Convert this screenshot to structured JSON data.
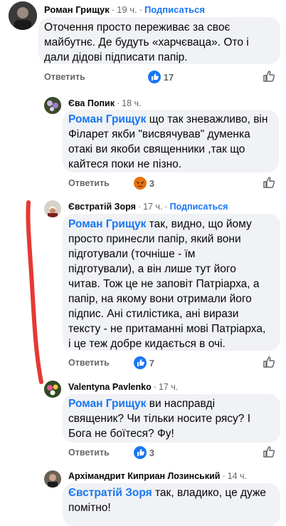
{
  "comments": [
    {
      "author": "Роман Грищук",
      "time": "19 ч.",
      "follow": "Подписаться",
      "mention": "",
      "lines": [
        "Оточення просто переживає за своє",
        "майбутнє. Де будуть «харчєваца». Ото і",
        "дали дідові підписати папір."
      ],
      "reply": "Ответить",
      "reaction_count": "17"
    },
    {
      "author": "Єва Попик",
      "time": "18 ч.",
      "mention": "Роман Грищук",
      "first_line_rest": " що так зневажливо, він",
      "lines": [
        "Філарет якби \"висвячував\"  думенка",
        "отакі ви якоби священники ,так що",
        "кайтеся поки не пізно."
      ],
      "reply": "Ответить",
      "reaction_count": "3"
    },
    {
      "author": "Євстратій Зоря",
      "time": "17 ч.",
      "follow": "Подписаться",
      "mention": "Роман Грищук",
      "first_line_rest": " так, видно, що йому",
      "lines": [
        "просто принесли папір, який вони",
        "підготували (точніше - їм",
        "підготували), а він лише тут його",
        "читав. Тож це не заповіт Патріарха, а",
        "папір, на якому вони отримали його",
        "підпис. Ані стилістика, ані вирази",
        "тексту - не притаманні мові Патріарха,",
        "і це теж добре кидається в очі."
      ],
      "reply": "Ответить",
      "reaction_count": "7"
    },
    {
      "author": "Valentyna Pavlenko",
      "time": "17 ч.",
      "mention": "Роман Грищук",
      "first_line_rest": " ви насправді",
      "lines": [
        "священик? Чи тільки носите рясу? І",
        "Бога не боїтеся? Фу!"
      ],
      "reply": "Ответить",
      "reaction_count": "3"
    },
    {
      "author": "Архімандрит Киприан Лозинський",
      "time": "14 ч.",
      "mention": "Євстратій Зоря",
      "first_line_rest": " так, владико, це дуже",
      "lines": [
        "помітно!"
      ]
    }
  ],
  "colors": {
    "link": "#1877f2",
    "bubble": "#f0f2f5",
    "meta": "#65676b",
    "red_mark": "#e53935"
  }
}
